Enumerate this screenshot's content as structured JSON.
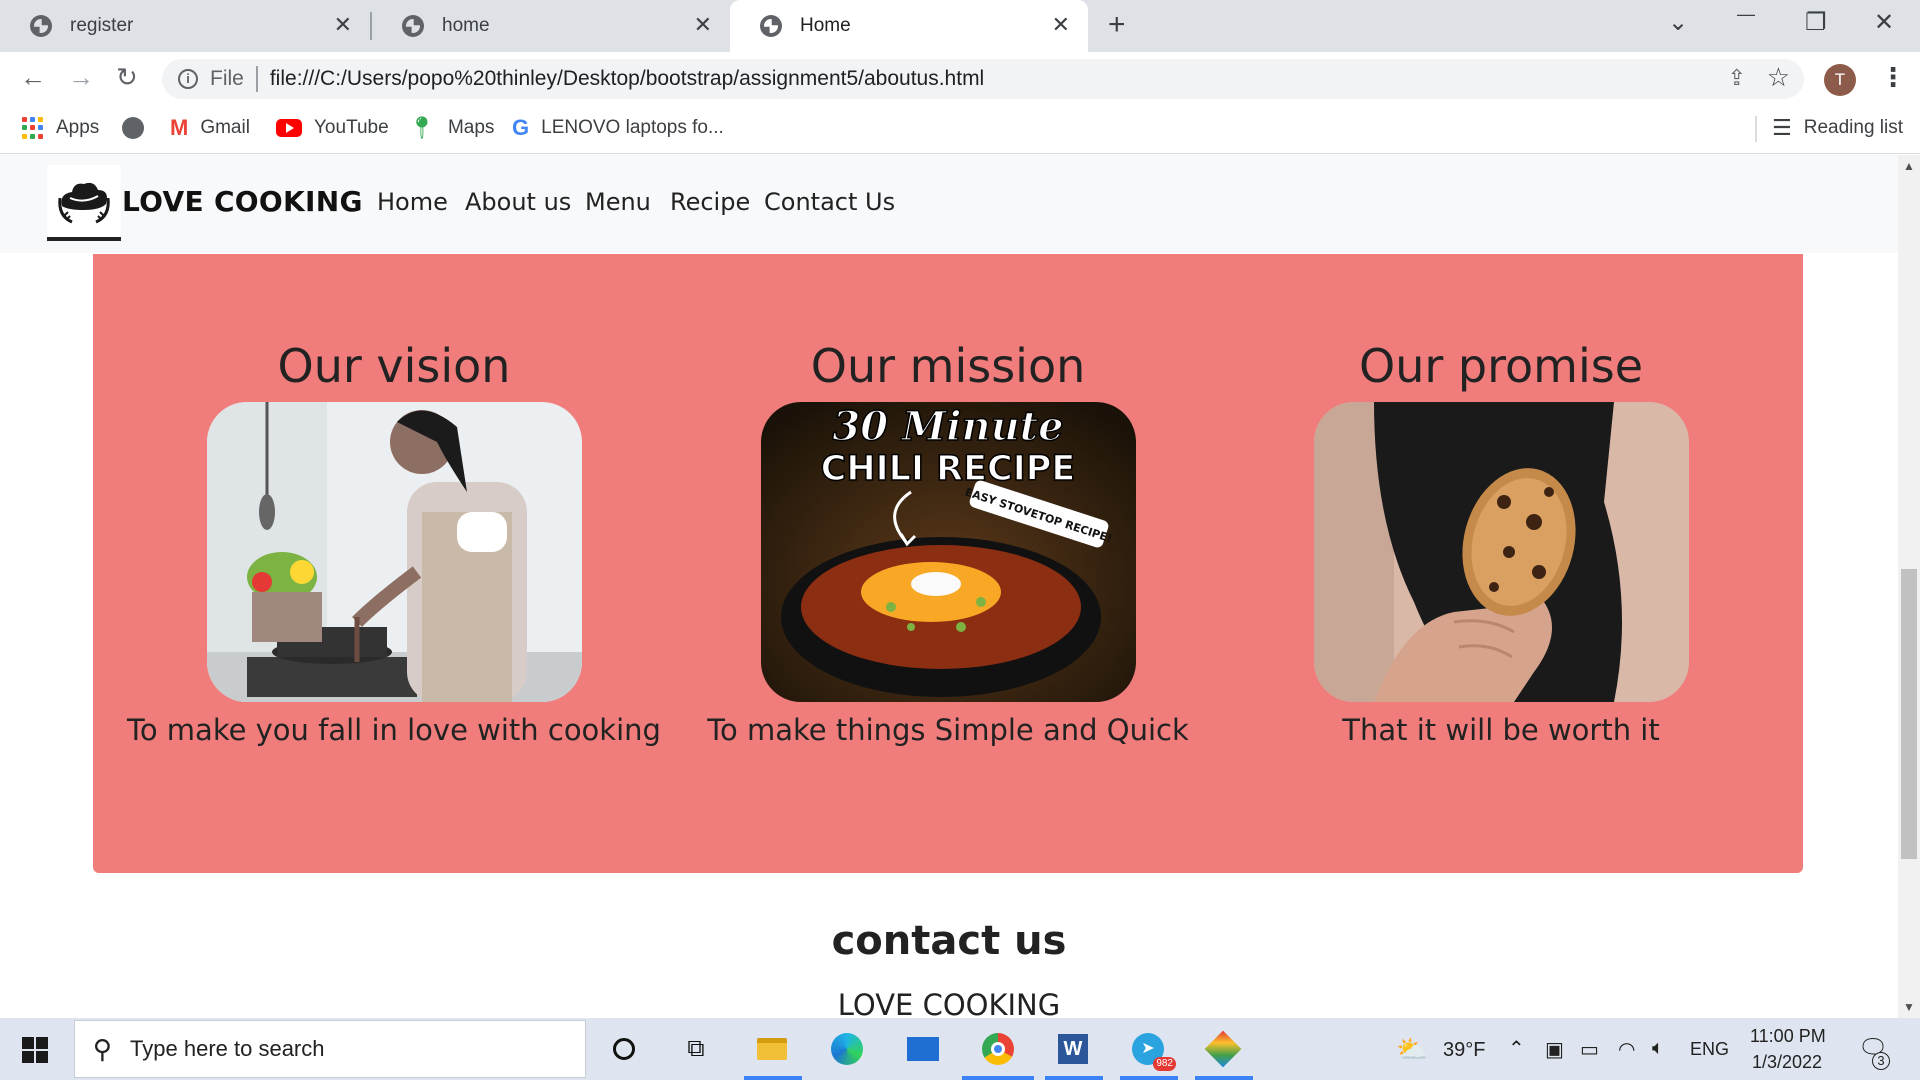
{
  "browser": {
    "tabs": [
      {
        "title": "register",
        "active": false
      },
      {
        "title": "home",
        "active": false
      },
      {
        "title": "Home",
        "active": true
      }
    ],
    "new_tab_symbol": "+",
    "window_controls": {
      "tab_search": "⌄",
      "minimize": "—",
      "restore": "❐",
      "close": "✕"
    },
    "address": {
      "scheme_label": "File",
      "url": "file:///C:/Users/popo%20thinley/Desktop/bootstrap/assignment5/aboutus.html"
    },
    "profile_initial": "T",
    "bookmarks": [
      {
        "label": "Apps",
        "icon": "apps-grid-icon"
      },
      {
        "label": "",
        "icon": "globe-icon"
      },
      {
        "label": "Gmail",
        "icon": "gmail-icon"
      },
      {
        "label": "YouTube",
        "icon": "youtube-icon"
      },
      {
        "label": "Maps",
        "icon": "maps-icon"
      },
      {
        "label": "LENOVO laptops fo...",
        "icon": "google-icon"
      }
    ],
    "reading_list": "Reading list"
  },
  "site": {
    "brand": "LOVE COOKING",
    "nav": [
      "Home",
      "About us",
      "Menu",
      "Recipe",
      "Contact Us"
    ],
    "cards": [
      {
        "title": "Our vision",
        "caption": "To make you fall in love with cooking",
        "photo": "woman-cooking-photo"
      },
      {
        "title": "Our mission",
        "caption": "To make things Simple and Quick",
        "photo": "chili-recipe-photo",
        "photo_text": {
          "line1": "30 Minute",
          "line2": "CHILI RECIPE",
          "badge": "EASY STOVETOP RECIPE!"
        }
      },
      {
        "title": "Our promise",
        "caption": "That it will be worth it",
        "photo": "cookie-hand-photo"
      }
    ],
    "contact_heading": "contact us",
    "contact_sub": "LOVE COOKING"
  },
  "taskbar": {
    "search_placeholder": "Type here to search",
    "weather": "39°F",
    "language": "ENG",
    "time": "11:00 PM",
    "date": "1/3/2022",
    "telegram_badge": "982",
    "notification_count": "3"
  },
  "colors": {
    "section_bg": "#f07d7b",
    "navbar_bg": "#f8f9fa",
    "tabstrip_bg": "#dee1e6",
    "taskbar_bg": "#dfe5f0"
  }
}
